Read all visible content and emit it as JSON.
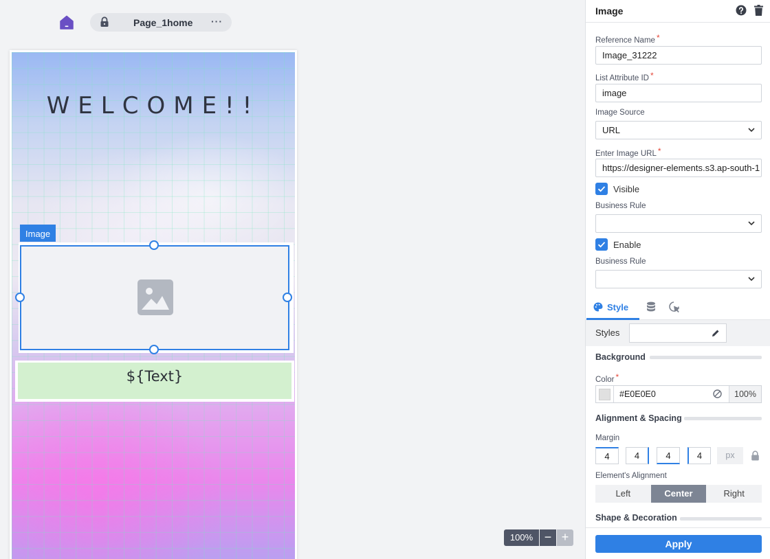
{
  "page_bar": {
    "page_name": "Page_1home",
    "more_label": "···"
  },
  "canvas": {
    "welcome_text": "WELCOME!!",
    "image_tag": "Image",
    "text_placeholder": "${Text}"
  },
  "zoom": {
    "value": "100%",
    "minus": "−",
    "plus": "+"
  },
  "panel": {
    "title": "Image",
    "reference_name_label": "Reference Name",
    "reference_name_value": "Image_31222",
    "list_attr_label": "List Attribute ID",
    "list_attr_value": "image",
    "image_source_label": "Image Source",
    "image_source_value": "URL",
    "image_url_label": "Enter Image URL",
    "image_url_value": "https://designer-elements.s3.ap-south-1",
    "visible_label": "Visible",
    "business_rule_label_1": "Business Rule",
    "enable_label": "Enable",
    "business_rule_label_2": "Business Rule",
    "required_mark": "*",
    "tab_style": "Style",
    "styles_label": "Styles",
    "background_title": "Background",
    "color_label": "Color",
    "color_value": "#E0E0E0",
    "opacity_value": "100%",
    "alignment_title": "Alignment & Spacing",
    "margin_label": "Margin",
    "margin_top": "4",
    "margin_right": "4",
    "margin_bottom": "4",
    "margin_left": "4",
    "margin_unit": "px",
    "element_alignment_label": "Element's Alignment",
    "align_left": "Left",
    "align_center": "Center",
    "align_right": "Right",
    "shape_title": "Shape & Decoration",
    "apply_label": "Apply"
  },
  "colors": {
    "accent": "#2f80e4",
    "home_icon": "#6a4fc4",
    "text_bg": "#d3f0cf",
    "swatch": "#E0E0E0"
  }
}
